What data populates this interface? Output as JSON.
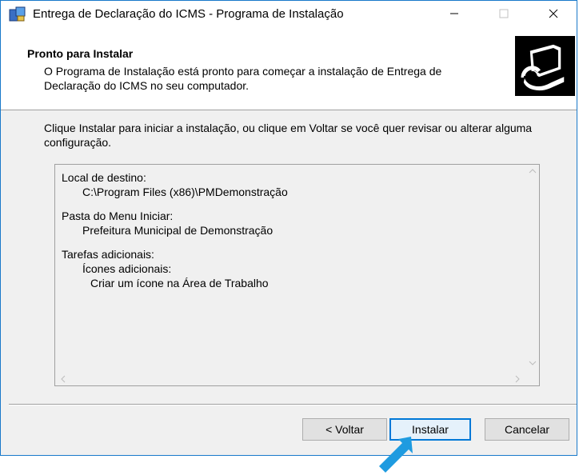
{
  "window": {
    "title": "Entrega de Declaração do ICMS - Programa de Instalação"
  },
  "titlebar_buttons": {
    "minimize": "—",
    "maximize": "☐",
    "close": "✕"
  },
  "header": {
    "title": "Pronto para Instalar",
    "description": "O Programa de Instalação está pronto para começar a instalação de Entrega de Declaração do ICMS no seu computador."
  },
  "intro_text": "Clique Instalar para iniciar a instalação, ou clique em Voltar se você quer revisar ou alterar alguma configuração.",
  "memo": {
    "dest_label": "Local de destino:",
    "dest_value": "C:\\Program Files (x86)\\PMDemonstração",
    "menu_label": "Pasta do Menu Iniciar:",
    "menu_value": "Prefeitura Municipal de Demonstração",
    "tasks_label": "Tarefas adicionais:",
    "tasks_sub": "Ícones adicionais:",
    "tasks_item": "Criar um ícone na Área de Trabalho"
  },
  "buttons": {
    "back": "< Voltar",
    "install": "Instalar",
    "cancel": "Cancelar"
  },
  "colors": {
    "accent": "#0078d7",
    "pointer": "#1e9be0"
  }
}
